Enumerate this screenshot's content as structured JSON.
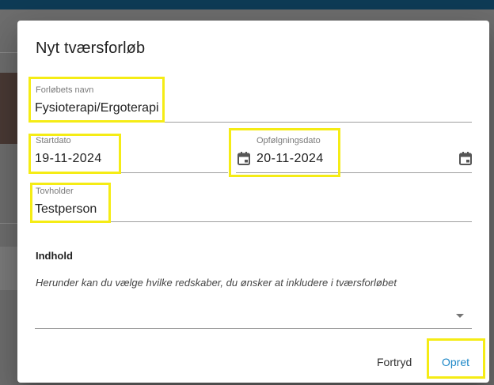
{
  "dialog": {
    "title": "Nyt tværsforløb"
  },
  "fields": {
    "name": {
      "label": "Forløbets navn",
      "value": "Fysioterapi/Ergoterapi"
    },
    "start_date": {
      "label": "Startdato",
      "value": "19-11-2024",
      "icon": "calendar-icon"
    },
    "followup_date": {
      "label": "Opfølgningsdato",
      "value": "20-11-2024",
      "icon": "calendar-icon"
    },
    "holder": {
      "label": "Tovholder",
      "value": "Testperson"
    }
  },
  "content_section": {
    "title": "Indhold",
    "description": "Herunder kan du vælge hvilke redskaber, du ønsker at inkludere i tværsforløbet",
    "select_value": "",
    "dropdown_icon": "arrow-drop-down-icon"
  },
  "actions": {
    "cancel_label": "Fortryd",
    "create_label": "Opret"
  },
  "colors": {
    "accent": "#1e88c8",
    "highlight": "#f5ec15",
    "topbar": "#0e3b56"
  }
}
